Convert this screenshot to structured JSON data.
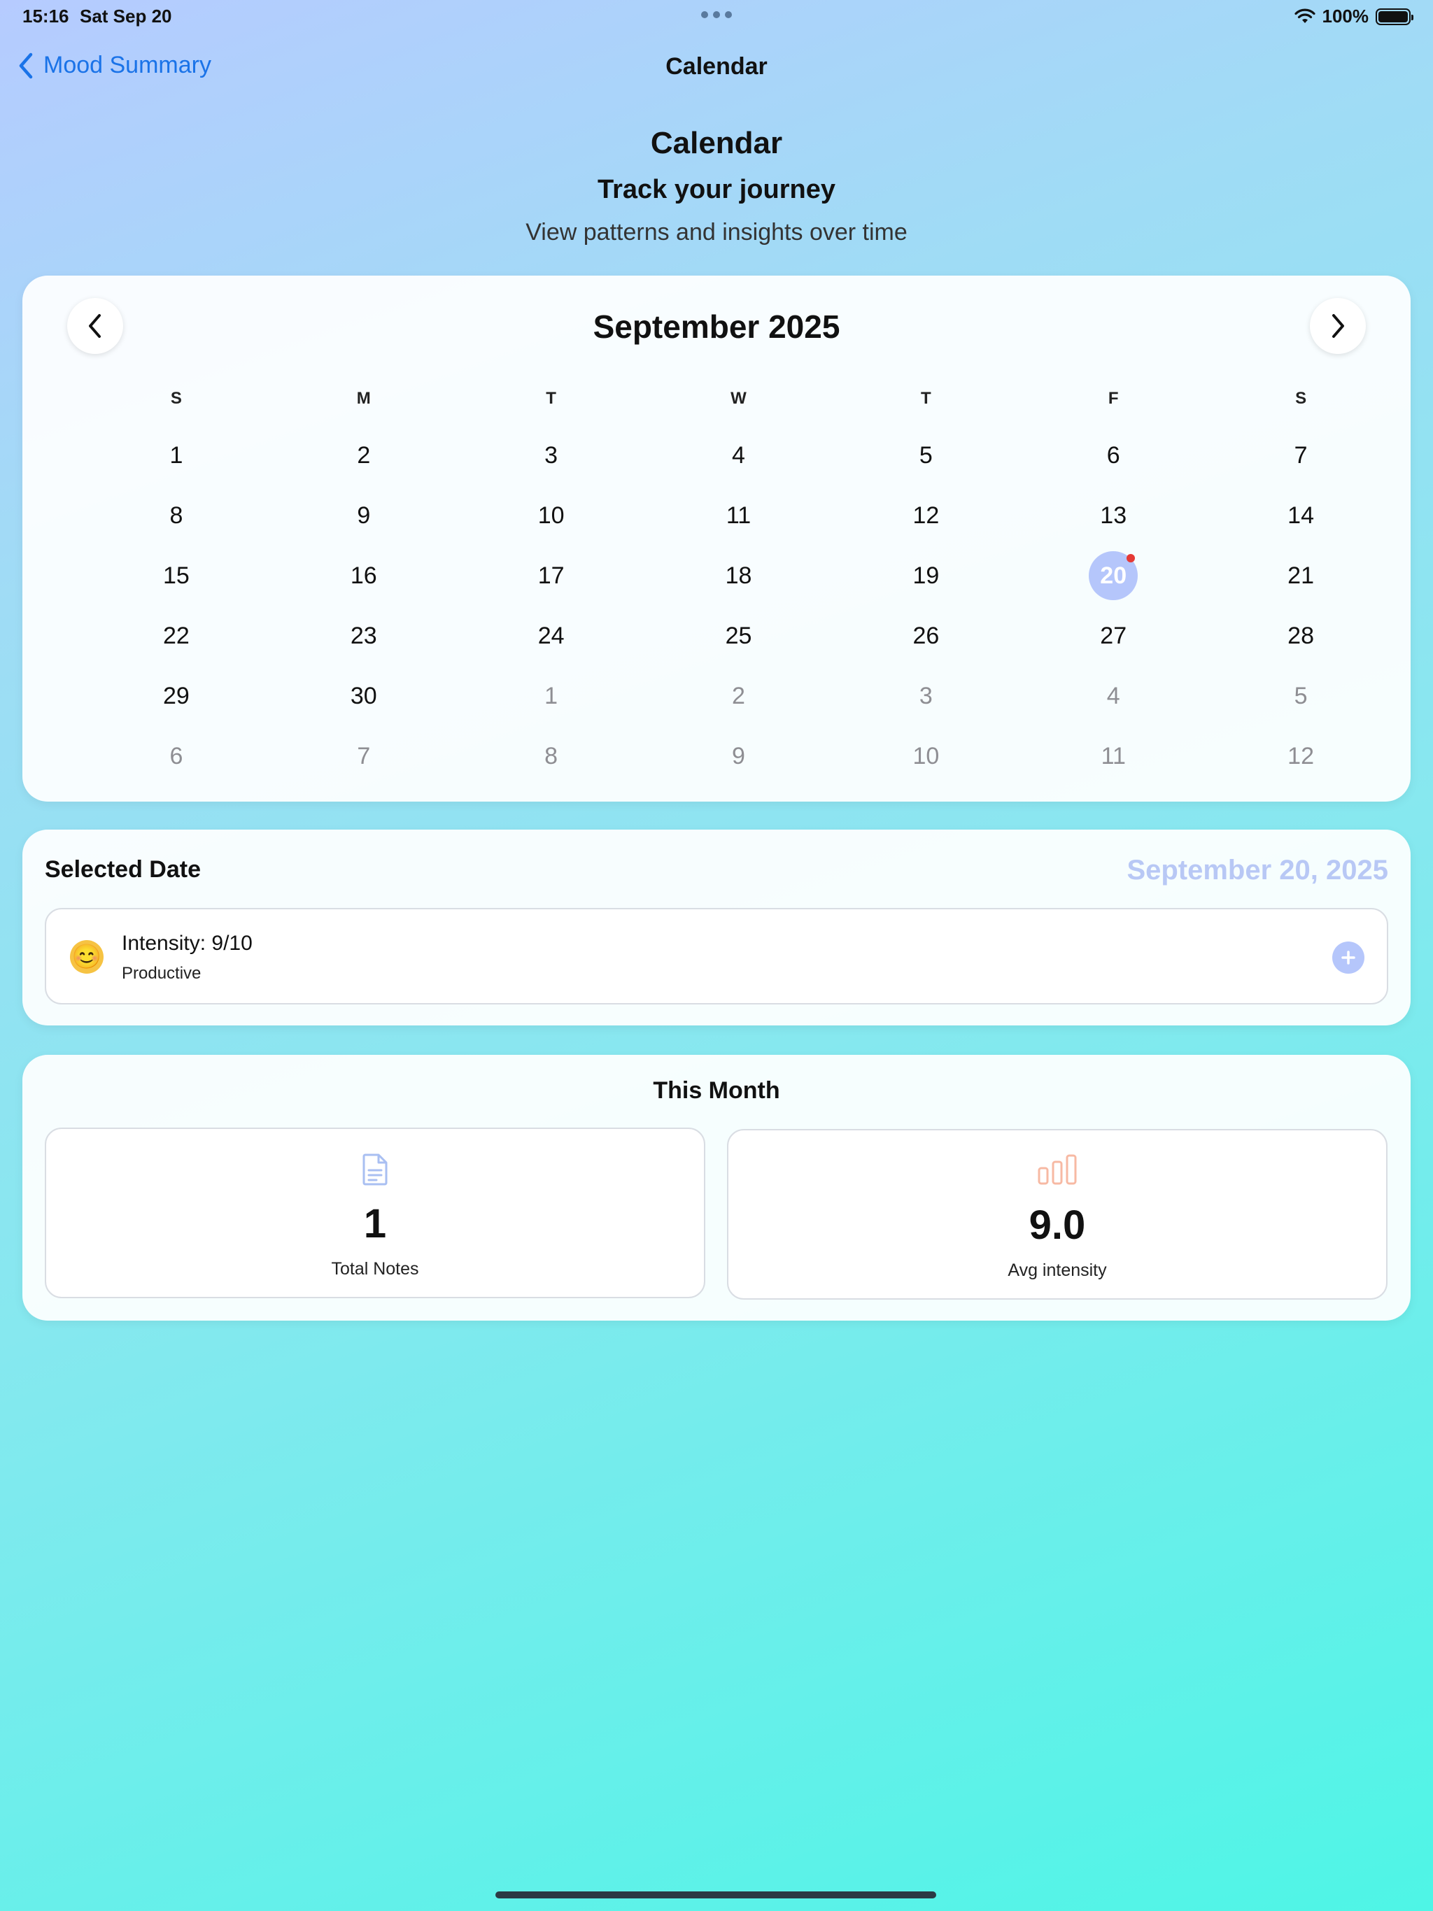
{
  "status_bar": {
    "time": "15:16",
    "date": "Sat Sep 20",
    "battery": "100%"
  },
  "nav": {
    "back_label": "Mood Summary",
    "title": "Calendar"
  },
  "header": {
    "title": "Calendar",
    "subtitle": "Track your journey",
    "description": "View patterns and insights over time"
  },
  "calendar": {
    "month_label": "September 2025",
    "weekdays": [
      "S",
      "M",
      "T",
      "W",
      "T",
      "F",
      "S"
    ],
    "days": [
      {
        "label": "1",
        "muted": false
      },
      {
        "label": "2",
        "muted": false
      },
      {
        "label": "3",
        "muted": false
      },
      {
        "label": "4",
        "muted": false
      },
      {
        "label": "5",
        "muted": false
      },
      {
        "label": "6",
        "muted": false
      },
      {
        "label": "7",
        "muted": false
      },
      {
        "label": "8",
        "muted": false
      },
      {
        "label": "9",
        "muted": false
      },
      {
        "label": "10",
        "muted": false
      },
      {
        "label": "11",
        "muted": false
      },
      {
        "label": "12",
        "muted": false
      },
      {
        "label": "13",
        "muted": false
      },
      {
        "label": "14",
        "muted": false
      },
      {
        "label": "15",
        "muted": false
      },
      {
        "label": "16",
        "muted": false
      },
      {
        "label": "17",
        "muted": false
      },
      {
        "label": "18",
        "muted": false
      },
      {
        "label": "19",
        "muted": false
      },
      {
        "label": "20",
        "muted": false,
        "selected": true,
        "has_entry": true
      },
      {
        "label": "21",
        "muted": false
      },
      {
        "label": "22",
        "muted": false
      },
      {
        "label": "23",
        "muted": false
      },
      {
        "label": "24",
        "muted": false
      },
      {
        "label": "25",
        "muted": false
      },
      {
        "label": "26",
        "muted": false
      },
      {
        "label": "27",
        "muted": false
      },
      {
        "label": "28",
        "muted": false
      },
      {
        "label": "29",
        "muted": false
      },
      {
        "label": "30",
        "muted": false
      },
      {
        "label": "1",
        "muted": true
      },
      {
        "label": "2",
        "muted": true
      },
      {
        "label": "3",
        "muted": true
      },
      {
        "label": "4",
        "muted": true
      },
      {
        "label": "5",
        "muted": true
      },
      {
        "label": "6",
        "muted": true
      },
      {
        "label": "7",
        "muted": true
      },
      {
        "label": "8",
        "muted": true
      },
      {
        "label": "9",
        "muted": true
      },
      {
        "label": "10",
        "muted": true
      },
      {
        "label": "11",
        "muted": true
      },
      {
        "label": "12",
        "muted": true
      }
    ]
  },
  "selected_date": {
    "label": "Selected Date",
    "date": "September 20, 2025",
    "entry": {
      "emoji": "😊",
      "intensity": "Intensity: 9/10",
      "tag": "Productive"
    }
  },
  "this_month": {
    "title": "This Month",
    "stats": [
      {
        "value": "1",
        "label": "Total Notes",
        "icon": "document-icon"
      },
      {
        "value": "9.0",
        "label": "Avg intensity",
        "icon": "bar-chart-icon"
      }
    ]
  },
  "colors": {
    "accent": "#1a73e8",
    "selected_day": "#b5c6fb",
    "entry_dot": "#e53935",
    "date_highlight": "#b8c8f5"
  }
}
